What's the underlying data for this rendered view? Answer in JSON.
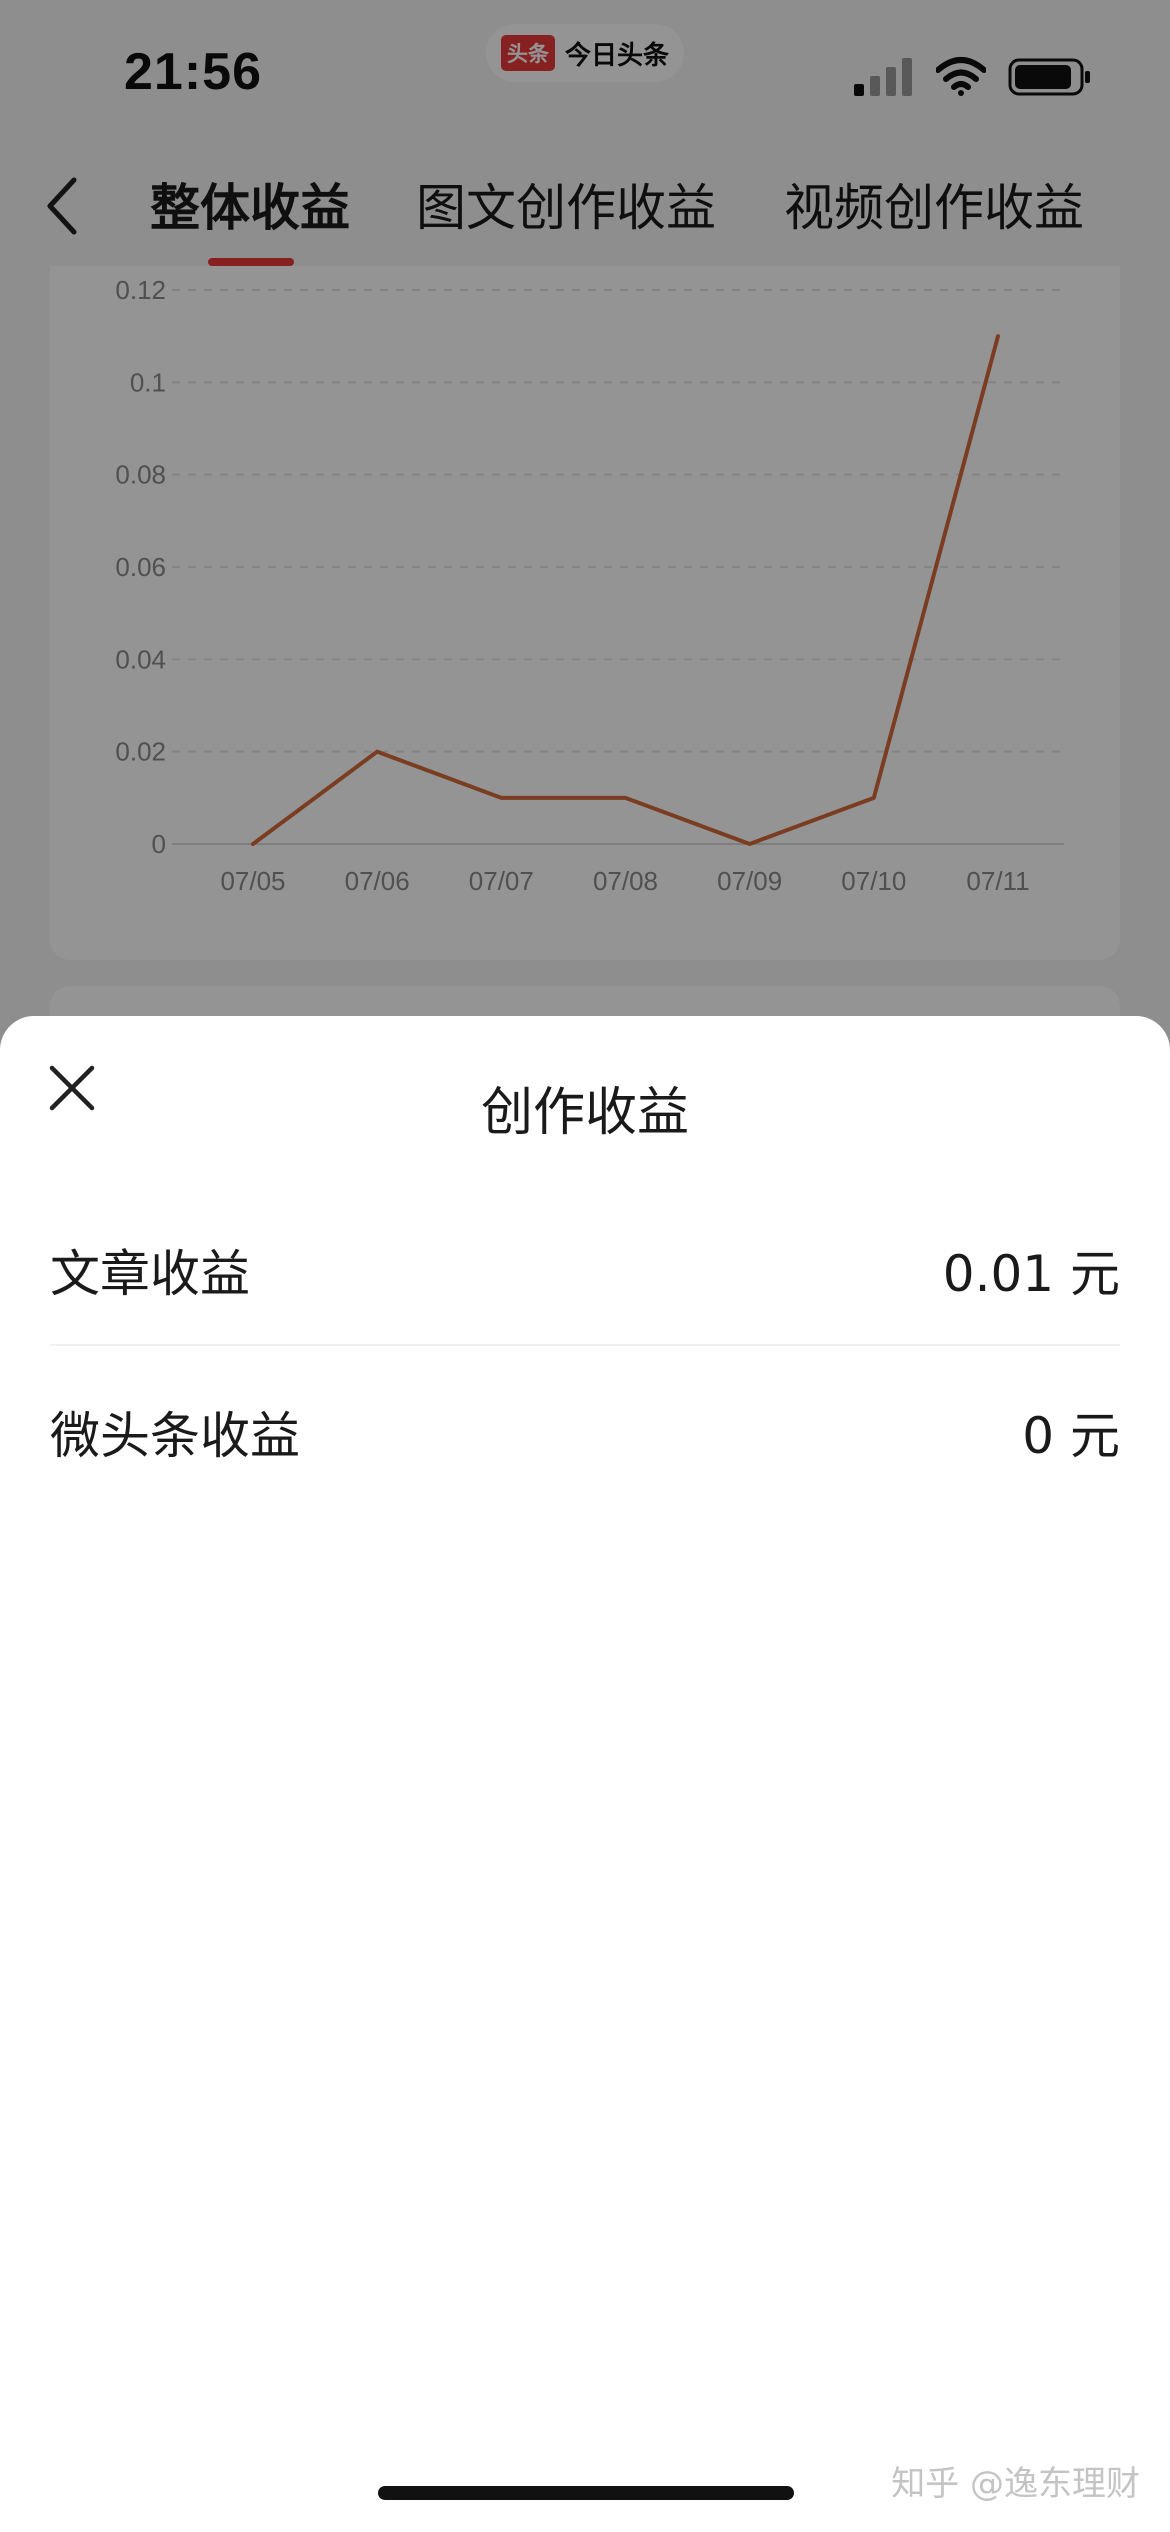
{
  "status_bar": {
    "time": "21:56",
    "app_logo_text": "头条",
    "app_name": "今日头条"
  },
  "header": {
    "tabs": [
      {
        "label": "整体收益",
        "active": true
      },
      {
        "label": "图文创作收益",
        "active": false
      },
      {
        "label": "视频创作收益",
        "active": false
      }
    ],
    "accent_color": "#e8393a"
  },
  "chart_data": {
    "type": "line",
    "categories": [
      "07/05",
      "07/06",
      "07/07",
      "07/08",
      "07/09",
      "07/10",
      "07/11"
    ],
    "series": [
      {
        "values": [
          0,
          0.02,
          0.01,
          0.01,
          0,
          0.01,
          0.11
        ],
        "color": "#d4693a"
      }
    ],
    "y_ticks": [
      "0",
      "0.02",
      "0.04",
      "0.06",
      "0.08",
      "0.1",
      "0.12"
    ],
    "ylim": [
      0,
      0.12
    ],
    "grid": true,
    "grid_style": "dashed"
  },
  "sheet": {
    "title": "创作收益",
    "rows": [
      {
        "label": "文章收益",
        "value": "0.01 元"
      },
      {
        "label": "微头条收益",
        "value": "0 元"
      }
    ]
  },
  "watermark": "知乎 @逸东理财"
}
